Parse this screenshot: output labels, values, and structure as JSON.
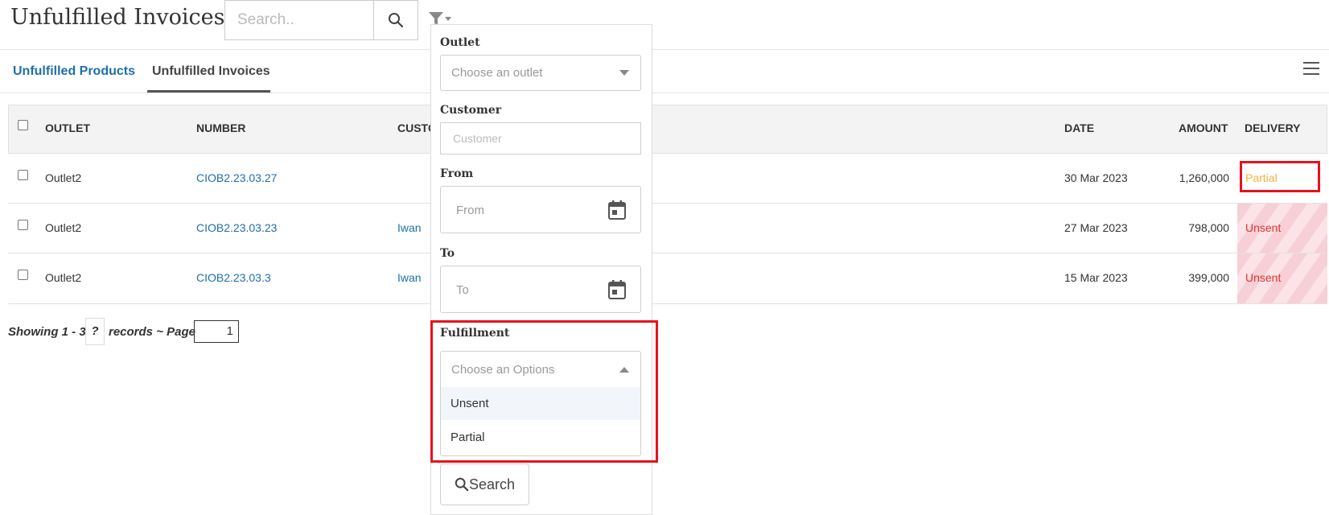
{
  "header": {
    "title": "Unfulfilled Invoices",
    "search_placeholder": "Search..",
    "search_icon": "search-icon",
    "filter_icon": "filter-icon"
  },
  "tabs": [
    {
      "label": "Unfulfilled Products",
      "active": false
    },
    {
      "label": "Unfulfilled Invoices",
      "active": true
    }
  ],
  "table": {
    "columns": [
      "OUTLET",
      "NUMBER",
      "CUSTO",
      "DATE",
      "AMOUNT",
      "DELIVERY"
    ],
    "rows": [
      {
        "outlet": "Outlet2",
        "number": "CIOB2.23.03.27",
        "customer": "",
        "date": "30 Mar 2023",
        "amount": "1,260,000",
        "delivery": "Partial"
      },
      {
        "outlet": "Outlet2",
        "number": "CIOB2.23.03.23",
        "customer": "Iwan",
        "date": "27 Mar 2023",
        "amount": "798,000",
        "delivery": "Unsent"
      },
      {
        "outlet": "Outlet2",
        "number": "CIOB2.23.03.3",
        "customer": "Iwan",
        "date": "15 Mar 2023",
        "amount": "399,000",
        "delivery": "Unsent"
      }
    ]
  },
  "footer": {
    "showing": "Showing 1 - 3",
    "total": "?",
    "records_page": "records ~ Page",
    "page": "1"
  },
  "filter_panel": {
    "outlet_label": "Outlet",
    "outlet_placeholder": "Choose an outlet",
    "customer_label": "Customer",
    "customer_placeholder": "Customer",
    "from_label": "From",
    "from_placeholder": "From",
    "to_label": "To",
    "to_placeholder": "To",
    "fulfillment_label": "Fulfillment",
    "fulfillment_placeholder": "Choose an Options",
    "fulfillment_options": [
      "Unsent",
      "Partial"
    ],
    "search_button": "Search"
  },
  "colors": {
    "link": "#1e6fa9",
    "unsent": "#e3342f",
    "partial": "#f0b33a",
    "highlight": "#e8121b"
  }
}
